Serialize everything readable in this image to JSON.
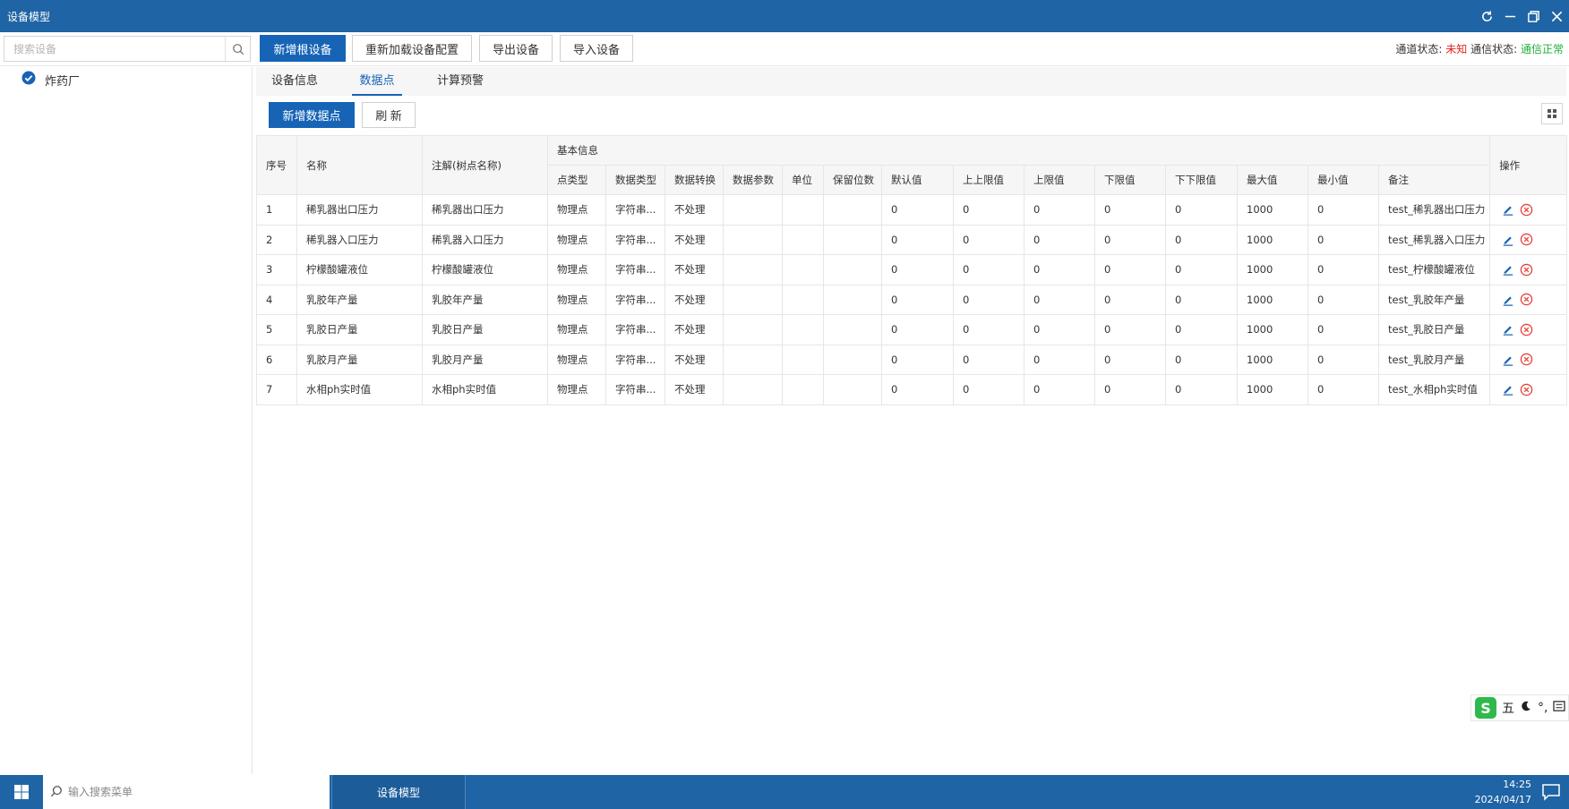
{
  "window": {
    "title": "设备模型"
  },
  "toolbar": {
    "search_placeholder": "搜索设备",
    "buttons": [
      "新增根设备",
      "重新加载设备配置",
      "导出设备",
      "导入设备"
    ],
    "channel_label": "通道状态:",
    "channel_value": "未知",
    "comm_label": "通信状态:",
    "comm_value": "通信正常"
  },
  "tree": {
    "root": "炸药厂"
  },
  "tabs": [
    "设备信息",
    "数据点",
    "计算预警"
  ],
  "actions": {
    "add": "新增数据点",
    "refresh": "刷 新"
  },
  "table": {
    "headers": {
      "seq": "序号",
      "name": "名称",
      "note": "注解(树点名称)",
      "group": "基本信息",
      "ops": "操作",
      "sub": [
        "点类型",
        "数据类型",
        "数据转换",
        "数据参数",
        "单位",
        "保留位数",
        "默认值",
        "上上限值",
        "上限值",
        "下限值",
        "下下限值",
        "最大值",
        "最小值",
        "备注"
      ]
    },
    "rows": [
      [
        "1",
        "稀乳器出口压力",
        "稀乳器出口压力",
        "物理点",
        "字符串...",
        "不处理",
        "",
        "",
        "",
        "0",
        "0",
        "0",
        "0",
        "0",
        "1000",
        "0",
        "test_稀乳器出口压力"
      ],
      [
        "2",
        "稀乳器入口压力",
        "稀乳器入口压力",
        "物理点",
        "字符串...",
        "不处理",
        "",
        "",
        "",
        "0",
        "0",
        "0",
        "0",
        "0",
        "1000",
        "0",
        "test_稀乳器入口压力"
      ],
      [
        "3",
        "柠檬酸罐液位",
        "柠檬酸罐液位",
        "物理点",
        "字符串...",
        "不处理",
        "",
        "",
        "",
        "0",
        "0",
        "0",
        "0",
        "0",
        "1000",
        "0",
        "test_柠檬酸罐液位"
      ],
      [
        "4",
        "乳胶年产量",
        "乳胶年产量",
        "物理点",
        "字符串...",
        "不处理",
        "",
        "",
        "",
        "0",
        "0",
        "0",
        "0",
        "0",
        "1000",
        "0",
        "test_乳胶年产量"
      ],
      [
        "5",
        "乳胶日产量",
        "乳胶日产量",
        "物理点",
        "字符串...",
        "不处理",
        "",
        "",
        "",
        "0",
        "0",
        "0",
        "0",
        "0",
        "1000",
        "0",
        "test_乳胶日产量"
      ],
      [
        "6",
        "乳胶月产量",
        "乳胶月产量",
        "物理点",
        "字符串...",
        "不处理",
        "",
        "",
        "",
        "0",
        "0",
        "0",
        "0",
        "0",
        "1000",
        "0",
        "test_乳胶月产量"
      ],
      [
        "7",
        "水相ph实时值",
        "水相ph实时值",
        "物理点",
        "字符串...",
        "不处理",
        "",
        "",
        "",
        "0",
        "0",
        "0",
        "0",
        "0",
        "1000",
        "0",
        "test_水相ph实时值"
      ]
    ]
  },
  "ime": {
    "mode": "五",
    "punct": "°,"
  },
  "taskbar": {
    "search_placeholder": "输入搜索菜单",
    "app": "设备模型",
    "time": "14:25",
    "date": "2024/04/17"
  },
  "icons": {
    "tree_check": "check-circle-icon",
    "edit": "edit-pencil-icon",
    "delete": "delete-circle-x-icon"
  },
  "colors": {
    "brand": "#1f64a5",
    "primary_button": "#1764b6",
    "status_unknown": "#e0261f",
    "status_ok": "#1fae3a",
    "delete_icon": "#e8413a"
  }
}
